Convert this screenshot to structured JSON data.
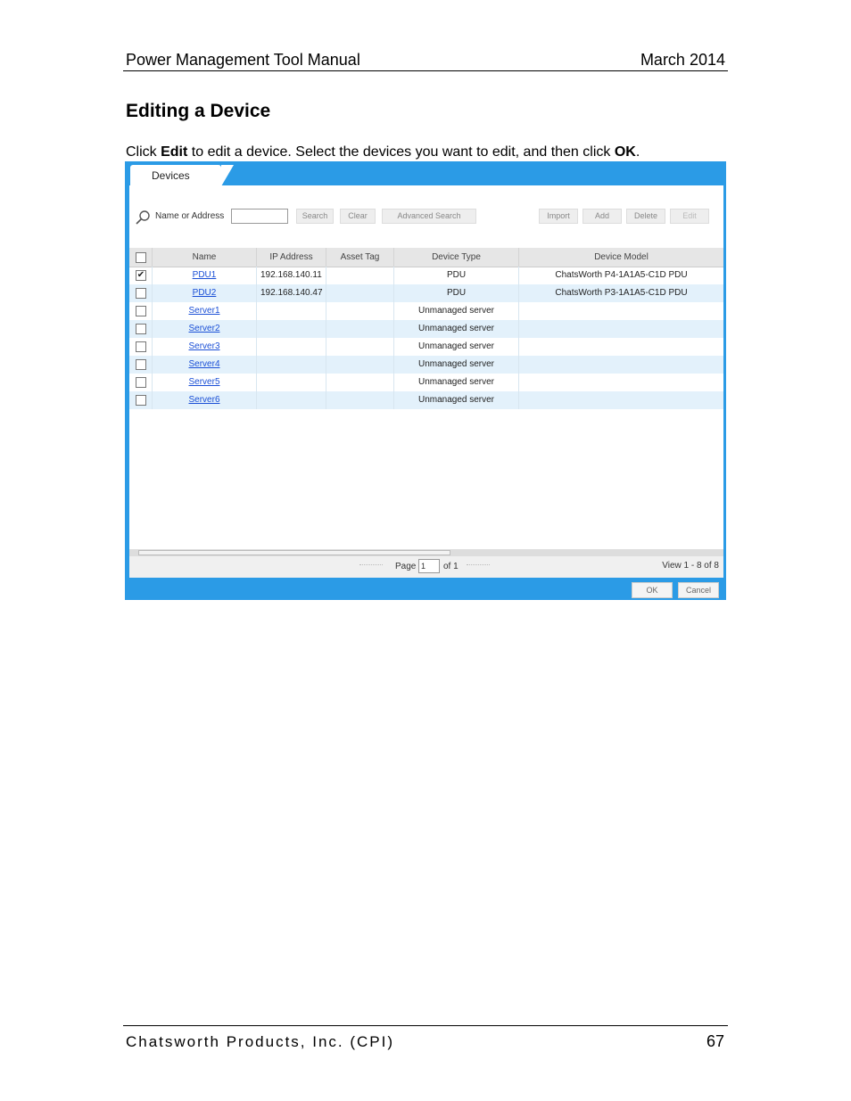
{
  "header": {
    "title": "Power Management Tool Manual",
    "date": "March 2014"
  },
  "section": {
    "heading": "Editing a Device"
  },
  "paragraph": {
    "pre": "Click ",
    "edit": "Edit",
    "mid": " to edit a device. Select the devices you want to edit, and then click ",
    "ok": "OK",
    "post": "."
  },
  "screenshot": {
    "tab_label": "Devices",
    "toolbar": {
      "search_label": "Name or Address",
      "search_value": "",
      "search_button": "Search",
      "clear_button": "Clear",
      "advanced_button": "Advanced Search",
      "import_button": "Import",
      "add_button": "Add",
      "delete_button": "Delete",
      "edit_button": "Edit"
    },
    "columns": [
      "Name",
      "IP Address",
      "Asset Tag",
      "Device Type",
      "Device Model"
    ],
    "rows": [
      {
        "checked": true,
        "name": "PDU1",
        "ip": "192.168.140.11",
        "asset": "",
        "type": "PDU",
        "model": "ChatsWorth P4-1A1A5-C1D PDU"
      },
      {
        "checked": false,
        "name": "PDU2",
        "ip": "192.168.140.47",
        "asset": "",
        "type": "PDU",
        "model": "ChatsWorth P3-1A1A5-C1D PDU"
      },
      {
        "checked": false,
        "name": "Server1",
        "ip": "",
        "asset": "",
        "type": "Unmanaged server",
        "model": ""
      },
      {
        "checked": false,
        "name": "Server2",
        "ip": "",
        "asset": "",
        "type": "Unmanaged server",
        "model": ""
      },
      {
        "checked": false,
        "name": "Server3",
        "ip": "",
        "asset": "",
        "type": "Unmanaged server",
        "model": ""
      },
      {
        "checked": false,
        "name": "Server4",
        "ip": "",
        "asset": "",
        "type": "Unmanaged server",
        "model": ""
      },
      {
        "checked": false,
        "name": "Server5",
        "ip": "",
        "asset": "",
        "type": "Unmanaged server",
        "model": ""
      },
      {
        "checked": false,
        "name": "Server6",
        "ip": "",
        "asset": "",
        "type": "Unmanaged server",
        "model": ""
      }
    ],
    "pager": {
      "page_label": "Page",
      "page_value": "1",
      "of_label": "of 1",
      "view_label": "View 1 - 8 of 8"
    },
    "footer": {
      "ok_button": "OK",
      "cancel_button": "Cancel"
    }
  },
  "footer": {
    "company": "Chatsworth Products, Inc. (CPI)",
    "page_number": "67"
  }
}
